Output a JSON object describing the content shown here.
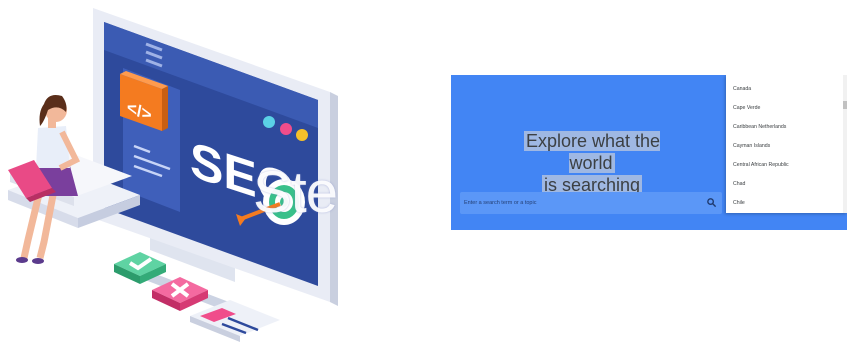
{
  "illustration": {
    "code_icon_glyph": "</>",
    "monitor_text": "SEO",
    "overlay_text": "Ste",
    "colors": {
      "monitor_screen": "#2e4a9c",
      "monitor_frame": "#e9ecf5",
      "code_tile": "#f47b20",
      "check_tile": "#39c08a",
      "cross_tile": "#f04d8b",
      "dot_cyan": "#5bd1e6",
      "dot_pink": "#f04d8b",
      "dot_yellow": "#f5c02a"
    }
  },
  "trends": {
    "background_color": "#4285f4",
    "hero": {
      "line1": "Explore what the world",
      "line2": "is searching"
    },
    "search": {
      "placeholder": "Enter a search term or a topic",
      "value": ""
    },
    "country_dropdown": {
      "options": [
        "Canada",
        "Cape Verde",
        "Caribbean Netherlands",
        "Cayman Islands",
        "Central African Republic",
        "Chad",
        "Chile"
      ]
    }
  }
}
